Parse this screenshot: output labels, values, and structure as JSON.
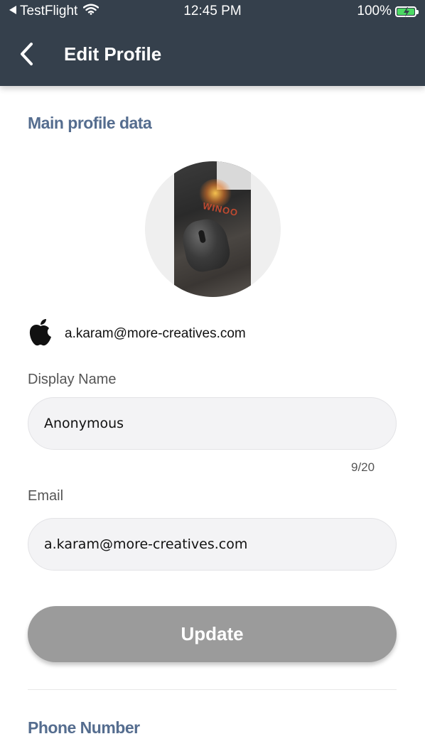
{
  "status_bar": {
    "back_app": "TestFlight",
    "time": "12:45 PM",
    "battery": "100%",
    "battery_level": 1.0,
    "icons": [
      "back-arrow-icon",
      "wifi-icon",
      "battery-charging-icon"
    ]
  },
  "nav": {
    "title": "Edit Profile",
    "back_icon": "chevron-left-icon"
  },
  "main_section": {
    "title": "Main profile data",
    "avatar_photo_text": "WINOO",
    "apple_account": {
      "icon": "apple-icon",
      "email": "a.karam@more-creatives.com"
    }
  },
  "form": {
    "display_name": {
      "label": "Display Name",
      "value": "Anonymous",
      "counter": "9/20"
    },
    "email": {
      "label": "Email",
      "value": "a.karam@more-creatives.com"
    },
    "update_label": "Update"
  },
  "phone_section": {
    "title": "Phone Number"
  },
  "colors": {
    "header_bg": "#35404c",
    "section_title": "#556d8f",
    "button_disabled": "#9b9b9b",
    "field_bg": "#f3f3f5",
    "battery_green": "#4cd964"
  }
}
